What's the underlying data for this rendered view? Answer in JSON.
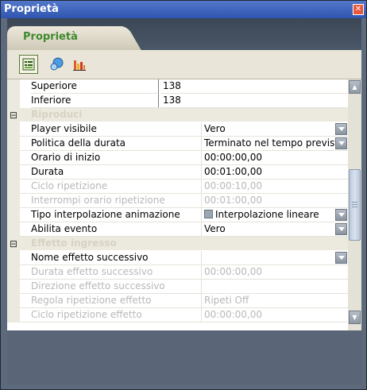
{
  "window": {
    "title": "Proprietà",
    "close_symbol": "✕"
  },
  "tab": {
    "label": "Proprietà"
  },
  "toolbar": {
    "buttons": [
      {
        "icon": "properties-icon",
        "active": true
      },
      {
        "icon": "shapes-icon",
        "active": false
      },
      {
        "icon": "bar-chart-icon",
        "active": false
      }
    ]
  },
  "grid": {
    "rows": [
      {
        "kind": "subtop",
        "name": "Superiore",
        "value": "138"
      },
      {
        "kind": "subtop",
        "name": "Inferiore",
        "value": "138"
      },
      {
        "kind": "cat",
        "toggle": "⊟",
        "name": "Riproduci"
      },
      {
        "kind": "prop",
        "name": "Player visibile",
        "value": "Vero",
        "dropdown": true
      },
      {
        "kind": "prop",
        "name": "Politica della durata",
        "value": "Terminato nel tempo previsto",
        "dropdown": true
      },
      {
        "kind": "prop",
        "name": "Orario di inizio",
        "value": "00:00:00,00"
      },
      {
        "kind": "prop",
        "name": "Durata",
        "value": "00:01:00,00"
      },
      {
        "kind": "prop",
        "name": "Ciclo ripetizione",
        "value": "00:00:10,00",
        "disabled": true
      },
      {
        "kind": "prop",
        "name": "Interrompi orario ripetizione",
        "value": "00:01:00,00",
        "disabled": true
      },
      {
        "kind": "prop",
        "name": "Tipo interpolazione animazione",
        "value": "Interpolazione lineare",
        "icon": true,
        "dropdown": true
      },
      {
        "kind": "prop",
        "name": "Abilita evento",
        "value": "Vero",
        "dropdown": true
      },
      {
        "kind": "cat",
        "toggle": "⊟",
        "name": "Effetto ingresso"
      },
      {
        "kind": "prop",
        "name": "Nome effetto successivo",
        "value": "",
        "dropdown": true
      },
      {
        "kind": "prop",
        "name": "Durata effetto successivo",
        "value": "00:00:00,00",
        "disabled": true
      },
      {
        "kind": "prop",
        "name": "Direzione effetto successivo",
        "value": "",
        "disabled": true
      },
      {
        "kind": "prop",
        "name": "Regola ripetizione effetto",
        "value": "Ripeti Off",
        "disabled": true
      },
      {
        "kind": "prop",
        "name": "Ciclo ripetizione effetto",
        "value": "00:00:00,00",
        "disabled": true
      }
    ]
  },
  "scrollbar": {
    "up_symbol": "▲",
    "down_symbol": "▼"
  },
  "colors": {
    "title_bar": "#2f55b0",
    "tab_text": "#3f8a2d",
    "category_text": "#d7d3c3"
  }
}
